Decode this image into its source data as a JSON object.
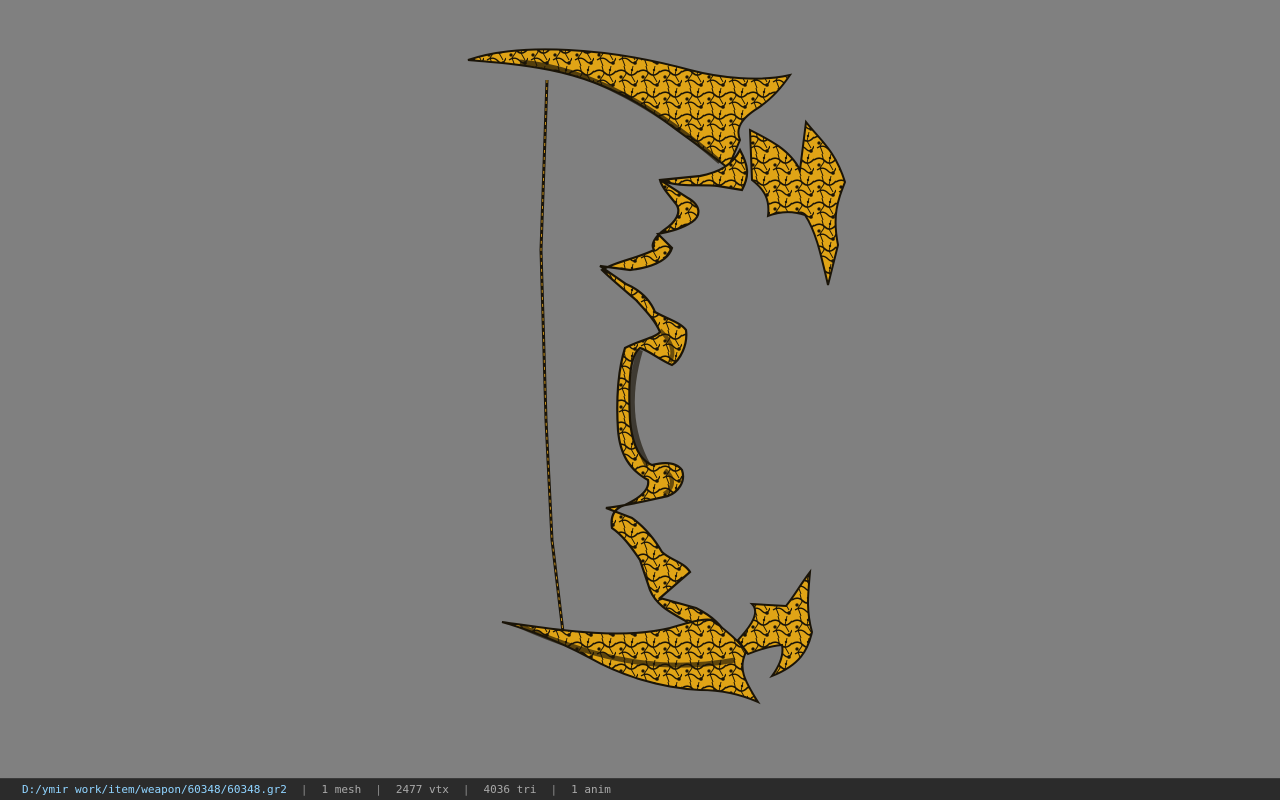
{
  "viewer": {
    "background_color": "#808080",
    "model": {
      "icon": "bow-model",
      "primary_color": "#e3a514",
      "dark_color": "#1a1408"
    }
  },
  "statusbar": {
    "file_path": "D:/ymir work/item/weapon/60348/60348.gr2",
    "separator": "|",
    "mesh_count": "1 mesh",
    "vertex_count": "2477 vtx",
    "triangle_count": "4036 tri",
    "anim_count": "1 anim"
  }
}
